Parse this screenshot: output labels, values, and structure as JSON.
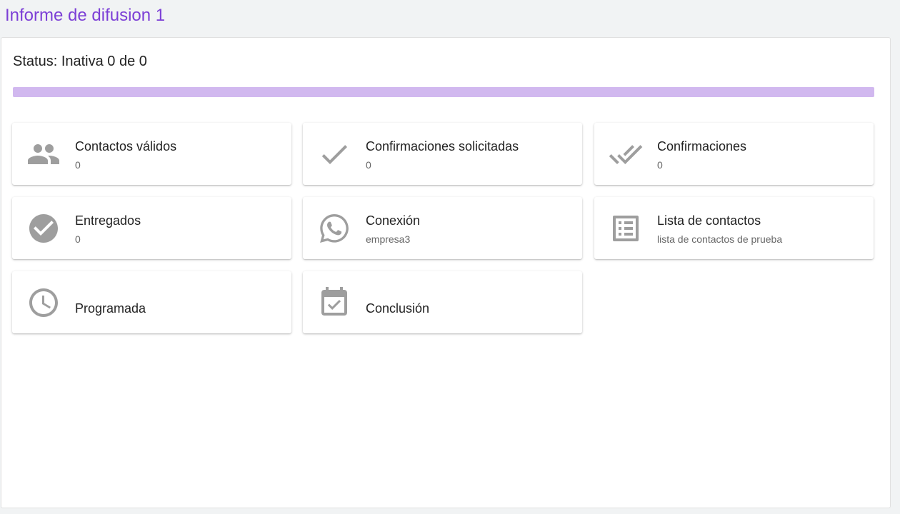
{
  "page": {
    "title": "Informe de difusion 1"
  },
  "status": {
    "text": "Status: Inativa 0 de 0",
    "progress_fraction": 0.0,
    "progress_track_color": "#d1b8ef",
    "progress_fill_color": "#7c3fd6"
  },
  "cards": {
    "valid_contacts": {
      "title": "Contactos válidos",
      "value": "0",
      "icon": "people-icon"
    },
    "requested_confirmations": {
      "title": "Confirmaciones solicitadas",
      "value": "0",
      "icon": "check-icon"
    },
    "confirmations": {
      "title": "Confirmaciones",
      "value": "0",
      "icon": "double-check-icon"
    },
    "delivered": {
      "title": "Entregados",
      "value": "0",
      "icon": "check-circle-icon"
    },
    "connection": {
      "title": "Conexión",
      "value": "empresa3",
      "icon": "whatsapp-icon"
    },
    "contact_list": {
      "title": "Lista de contactos",
      "value": "lista de contactos de prueba",
      "icon": "list-alt-icon"
    },
    "scheduled": {
      "title": "Programada",
      "icon": "clock-icon"
    },
    "completion": {
      "title": "Conclusión",
      "icon": "event-available-icon"
    }
  },
  "colors": {
    "accent": "#7c3fd6",
    "icon": "#9e9e9e"
  }
}
